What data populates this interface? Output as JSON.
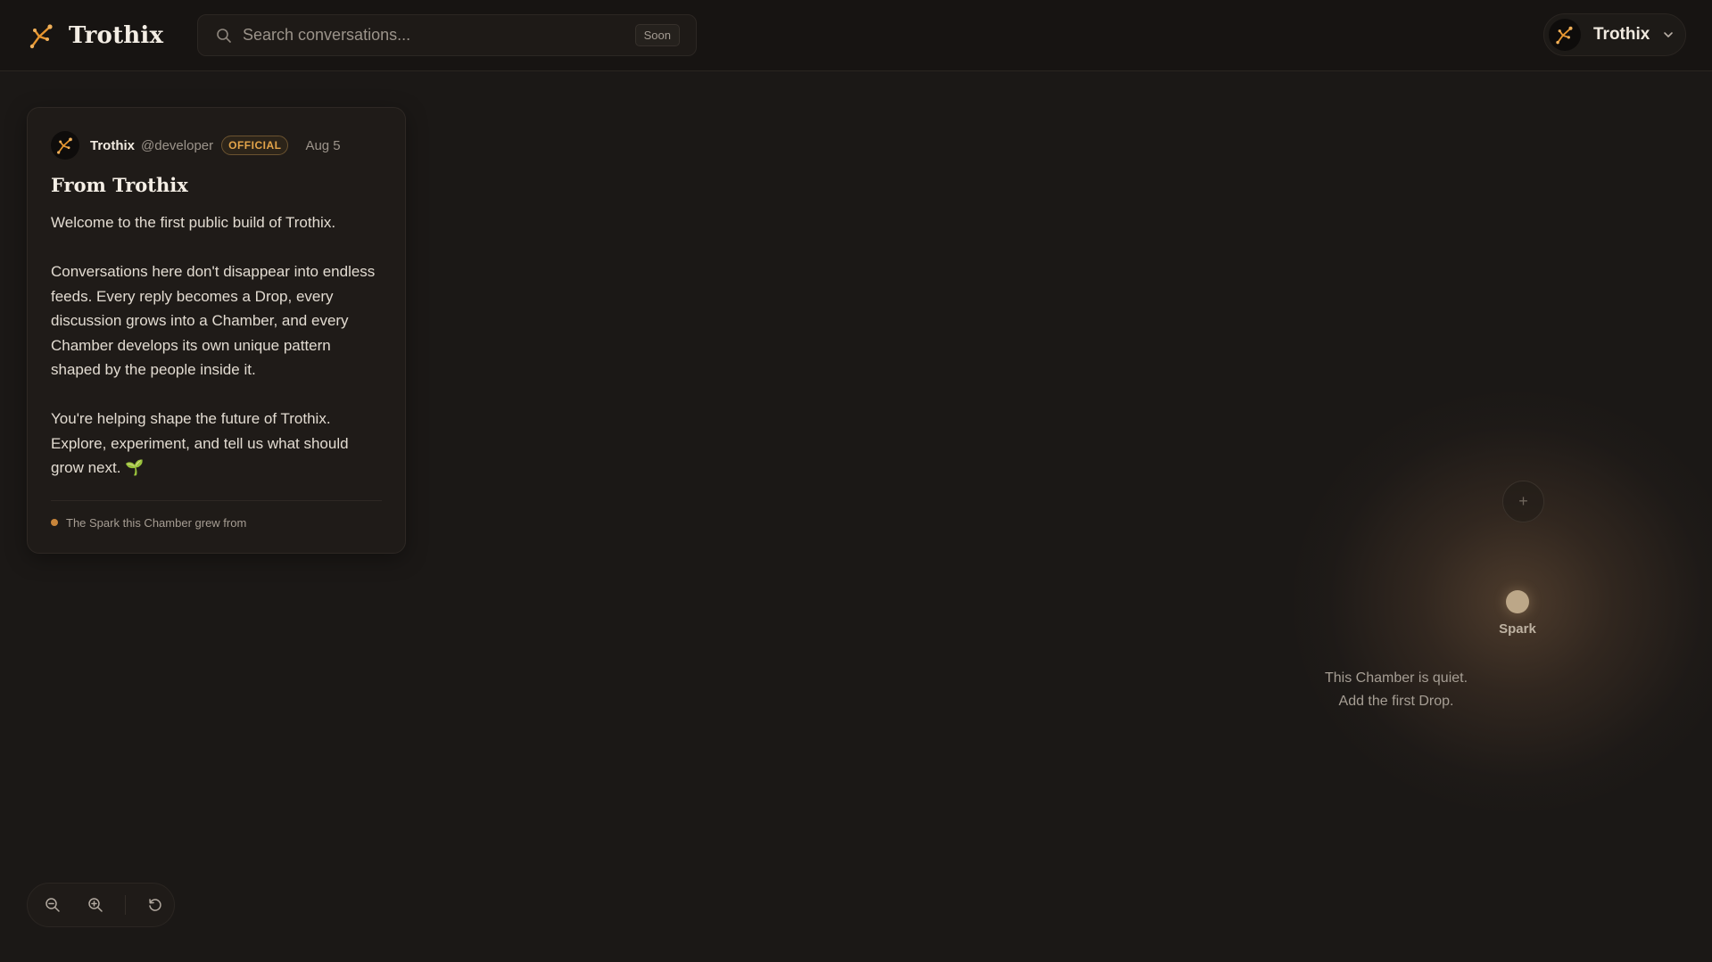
{
  "header": {
    "brand_name": "Trothix",
    "search": {
      "placeholder": "Search conversations...",
      "badge": "Soon"
    },
    "account": {
      "name": "Trothix"
    }
  },
  "post": {
    "author": "Trothix",
    "handle": "@developer",
    "badge": "OFFICIAL",
    "date": "Aug 5",
    "title": "From Trothix",
    "paragraphs": [
      "Welcome to the first public build of Trothix.",
      "Conversations here don't disappear into endless feeds. Every reply becomes a Drop, every discussion grows into a Chamber, and every Chamber develops its own unique pattern shaped by the people inside it.",
      "You're helping shape the future of Trothix. Explore, experiment, and tell us what should grow next. 🌱"
    ],
    "footer": "The Spark this Chamber grew from"
  },
  "canvas": {
    "spark_label": "Spark",
    "add_symbol": "+",
    "empty_state": [
      "This Chamber is quiet.",
      "Add the first Drop."
    ]
  },
  "colors": {
    "accent": "#e3a44a",
    "background": "#1b1816",
    "spark": "#bca788"
  },
  "icons": {
    "brand": "trothix-logo-icon",
    "search": "search-icon",
    "chevron": "chevron-down-icon",
    "zoom_out": "zoom-out-icon",
    "zoom_in": "zoom-in-icon",
    "reset": "reset-view-icon"
  }
}
